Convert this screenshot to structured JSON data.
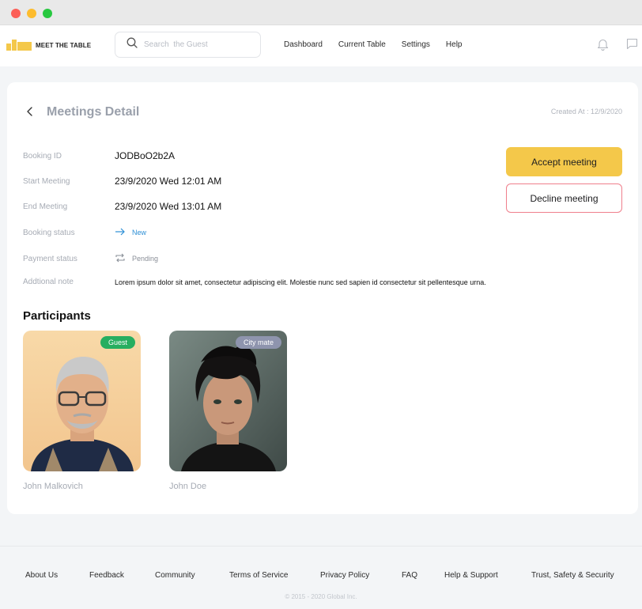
{
  "brand": {
    "name": "MEET THE TABLE",
    "accent": "#f4c84a"
  },
  "search": {
    "placeholder": "Search  the Guest"
  },
  "nav": {
    "links": [
      "Dashboard",
      "Current Table",
      "Settings",
      "Help"
    ],
    "icons": [
      "bell-icon",
      "chat-icon"
    ]
  },
  "page": {
    "title": "Meetings Detail",
    "created_at": "Created At : 12/9/2020"
  },
  "details": [
    {
      "label": "Booking ID",
      "value": "JODBoO2b2A"
    },
    {
      "label": "Start Meeting",
      "value": "23/9/2020 Wed 12:01 AM"
    },
    {
      "label": "End Meeting",
      "value": "23/9/2020 Wed 13:01 AM"
    },
    {
      "label": "Booking status",
      "value": "New",
      "color": "#2d8fd5",
      "icon": "arrow-right-icon"
    },
    {
      "label": "Payment status",
      "value": "Pending",
      "color": "#8a8f98",
      "icon": "repeat-icon"
    },
    {
      "label": "Addtional note",
      "value": "Lorem ipsum dolor sit amet, consectetur adipiscing elit. Molestie nunc sed sapien id consectetur sit pellentesque urna."
    }
  ],
  "actions": {
    "accept": "Accept meeting",
    "decline": "Decline meeting"
  },
  "participants": {
    "title": "Participants",
    "people": [
      {
        "name": "John Malkovich",
        "badge": "Guest",
        "badge_color": "#27ae60"
      },
      {
        "name": "John Doe",
        "badge": "City mate",
        "badge_color": "#8e94ad"
      }
    ]
  },
  "footer": {
    "links": [
      "About Us",
      "Feedback",
      "Community",
      "Terms of Service",
      "Privacy Policy",
      "FAQ",
      "Help & Support",
      "Trust, Safety & Security"
    ],
    "copyright": "© 2015 - 2020 Global Inc."
  }
}
